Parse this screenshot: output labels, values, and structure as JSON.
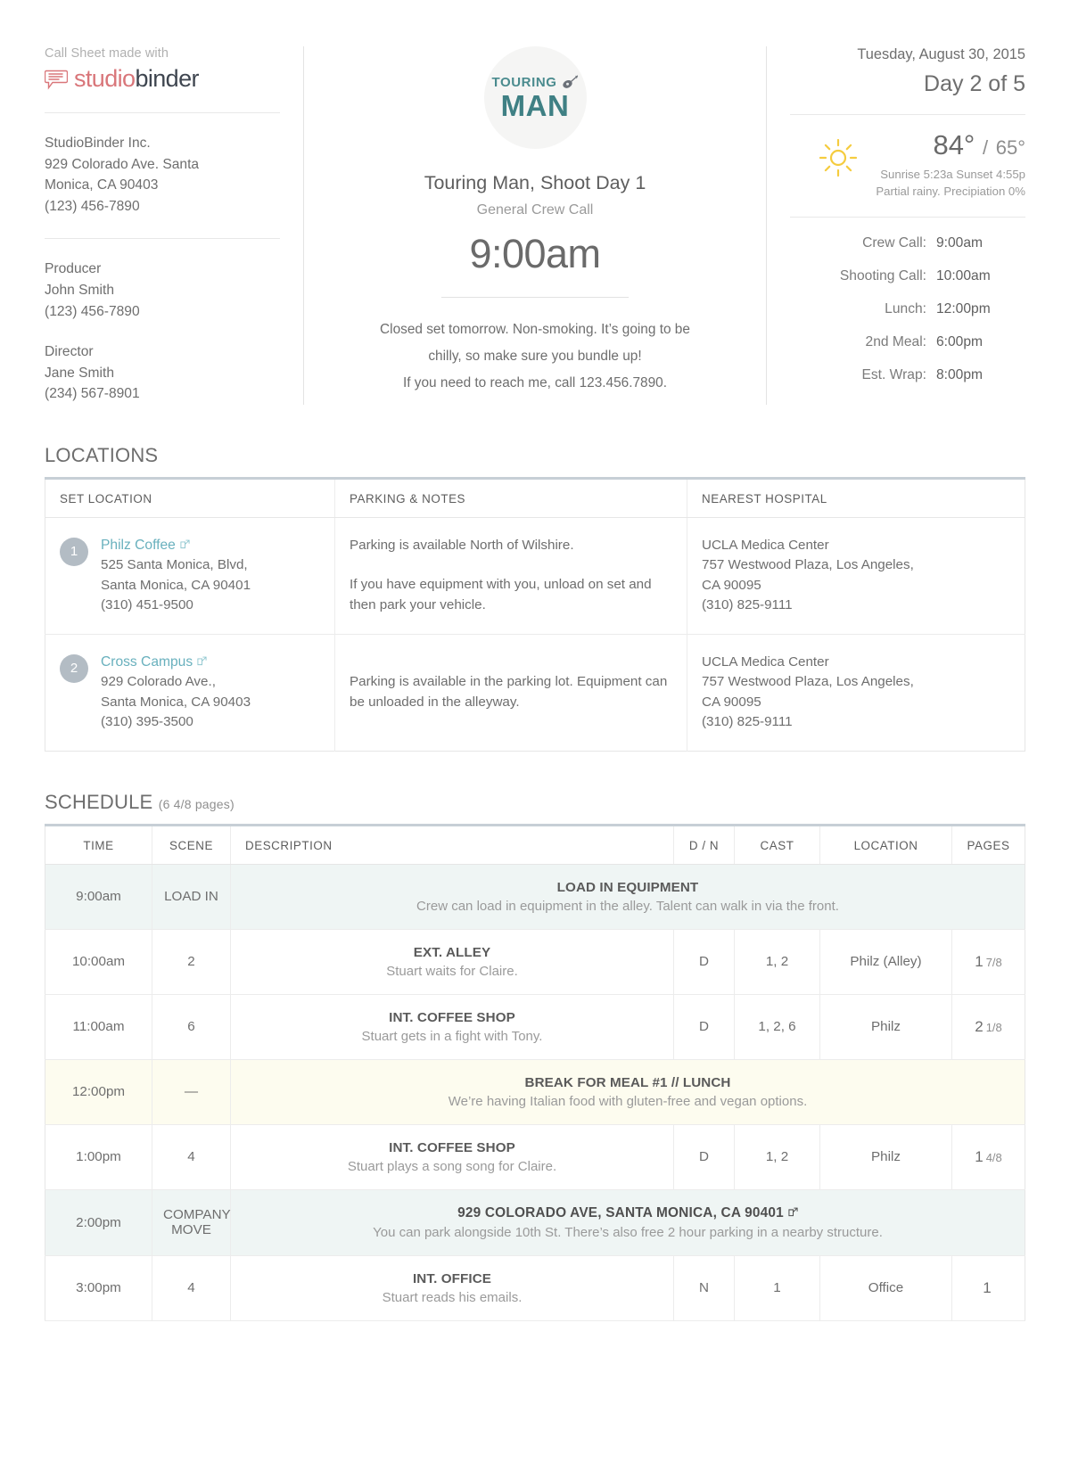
{
  "branding": {
    "made_with_label": "Call Sheet made with",
    "brand_first": "studio",
    "brand_second": "binder",
    "logo_icon": "speech-bubble-icon"
  },
  "company": {
    "name": "StudioBinder Inc.",
    "address_line1": "929 Colorado Ave. Santa",
    "address_line2": "Monica, CA 90403",
    "phone": "(123) 456-7890"
  },
  "contacts": [
    {
      "role": "Producer",
      "name": "John Smith",
      "phone": "(123) 456-7890"
    },
    {
      "role": "Director",
      "name": "Jane Smith",
      "phone": "(234) 567-8901"
    }
  ],
  "production": {
    "logo_text_top": "TOURING",
    "logo_text_bottom": "MAN",
    "logo_icon": "guitar-icon",
    "logo_color": "#3f8084",
    "title": "Touring Man, Shoot Day 1",
    "subtitle": "General Crew Call",
    "call_time": "9:00am",
    "notes_line1": "Closed set tomorrow. Non-smoking. It’s going to be",
    "notes_line2": "chilly, so make sure you bundle up!",
    "notes_line3": "If you need to reach me, call 123.456.7890."
  },
  "schedule_header": {
    "date": "Tuesday, August 30, 2015",
    "day_of": "Day 2 of 5",
    "weather": {
      "icon": "sun-icon",
      "icon_color": "#f5cc3f",
      "high": "84°",
      "separator": "/",
      "low": "65°",
      "sun_line": "Sunrise 5:23a  Sunset 4:55p",
      "conditions": "Partial rainy. Precipiation 0%"
    },
    "times": [
      {
        "label": "Crew Call:",
        "value": "9:00am"
      },
      {
        "label": "Shooting Call:",
        "value": "10:00am"
      },
      {
        "label": "Lunch:",
        "value": "12:00pm"
      },
      {
        "label": "2nd Meal:",
        "value": "6:00pm"
      },
      {
        "label": "Est. Wrap:",
        "value": "8:00pm"
      }
    ]
  },
  "locations": {
    "section_title": "LOCATIONS",
    "columns": [
      "SET LOCATION",
      "PARKING & NOTES",
      "NEAREST HOSPITAL"
    ],
    "rows": [
      {
        "badge": "1",
        "name": "Philz Coffee",
        "link_icon": "external-link-icon",
        "address_line1": "525 Santa Monica, Blvd,",
        "address_line2": "Santa Monica, CA 90401",
        "phone": "(310) 451-9500",
        "parking_p1": "Parking is available North of Wilshire.",
        "parking_p2": "If you have equipment with you, unload on set and then park your vehicle.",
        "hospital_name": "UCLA Medica Center",
        "hospital_addr1": "757 Westwood Plaza, Los Angeles,",
        "hospital_addr2": "CA 90095",
        "hospital_phone": "(310) 825-9111"
      },
      {
        "badge": "2",
        "name": "Cross Campus",
        "link_icon": "external-link-icon",
        "address_line1": "929 Colorado Ave.,",
        "address_line2": "Santa Monica, CA 90403",
        "phone": "(310) 395-3500",
        "parking_p1": "Parking is available in the parking lot. Equipment can be unloaded in the alleyway.",
        "parking_p2": "",
        "hospital_name": "UCLA Medica Center",
        "hospital_addr1": "757 Westwood Plaza, Los Angeles,",
        "hospital_addr2": "CA 90095",
        "hospital_phone": "(310) 825-9111"
      }
    ]
  },
  "schedule": {
    "section_title": "SCHEDULE",
    "pages_note": "(6 4/8 pages)",
    "columns": [
      "TIME",
      "SCENE",
      "DESCRIPTION",
      "D / N",
      "CAST",
      "LOCATION",
      "PAGES"
    ],
    "rows": [
      {
        "tint": "teal",
        "full_width": true,
        "time": "9:00am",
        "scene": "LOAD IN",
        "scene_small": true,
        "title": "LOAD IN EQUIPMENT",
        "subtitle": "Crew can load in equipment in the alley. Talent can walk in via the front.",
        "dn": "",
        "cast": "",
        "location": "",
        "pages_whole": "",
        "pages_frac": ""
      },
      {
        "tint": "none",
        "full_width": false,
        "time": "10:00am",
        "scene": "2",
        "scene_small": false,
        "title": "EXT. ALLEY",
        "subtitle": "Stuart waits for Claire.",
        "dn": "D",
        "cast": "1, 2",
        "location": "Philz (Alley)",
        "pages_whole": "1",
        "pages_frac": "7/8"
      },
      {
        "tint": "none",
        "full_width": false,
        "time": "11:00am",
        "scene": "6",
        "scene_small": false,
        "title": "INT. COFFEE SHOP",
        "subtitle": "Stuart gets in a fight with Tony.",
        "dn": "D",
        "cast": "1, 2, 6",
        "location": "Philz",
        "pages_whole": "2",
        "pages_frac": "1/8"
      },
      {
        "tint": "yellow",
        "full_width": true,
        "time": "12:00pm",
        "scene": "—",
        "scene_small": false,
        "title": "BREAK FOR MEAL #1 // LUNCH",
        "subtitle": "We’re having Italian food with gluten-free and vegan options.",
        "dn": "",
        "cast": "",
        "location": "",
        "pages_whole": "",
        "pages_frac": ""
      },
      {
        "tint": "none",
        "full_width": false,
        "time": "1:00pm",
        "scene": "4",
        "scene_small": false,
        "title": "INT. COFFEE SHOP",
        "subtitle": "Stuart plays a song song for Claire.",
        "dn": "D",
        "cast": "1, 2",
        "location": "Philz",
        "pages_whole": "1",
        "pages_frac": "4/8"
      },
      {
        "tint": "teal",
        "full_width": true,
        "time": "2:00pm",
        "scene": "COMPANY MOVE",
        "scene_small": true,
        "title": "929 COLORADO AVE, SANTA MONICA, CA 90401",
        "link_icon": "external-link-icon",
        "subtitle": "You can park alongside 10th St. There’s also free 2 hour parking in a nearby structure.",
        "dn": "",
        "cast": "",
        "location": "",
        "pages_whole": "",
        "pages_frac": ""
      },
      {
        "tint": "none",
        "full_width": false,
        "time": "3:00pm",
        "scene": "4",
        "scene_small": false,
        "title": "INT. OFFICE",
        "subtitle": "Stuart reads his emails.",
        "dn": "N",
        "cast": "1",
        "location": "Office",
        "pages_whole": "1",
        "pages_frac": ""
      }
    ]
  }
}
